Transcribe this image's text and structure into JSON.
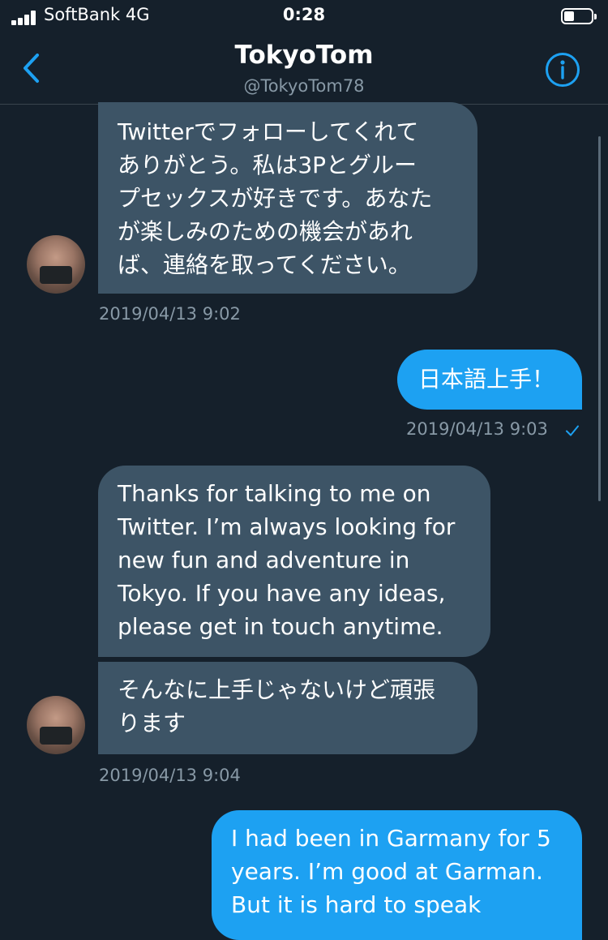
{
  "status_bar": {
    "carrier": "SoftBank 4G",
    "time": "0:28"
  },
  "header": {
    "title": "TokyoTom",
    "handle": "@TokyoTom78"
  },
  "messages": [
    {
      "direction": "received",
      "lines": [
        "Twitterでフォローしてくれて",
        "ありがとう。私は3Pとグルー",
        "プセックスが好きです。あなた",
        "が楽しみのための機会があれ",
        "ば、連絡を取ってください。"
      ]
    },
    {
      "direction": "sent",
      "lines": [
        "日本語上手！"
      ]
    },
    {
      "direction": "received",
      "lines": [
        "Thanks for talking to me on",
        "Twitter. I’m always looking for",
        "new fun and adventure in",
        "Tokyo. If you have any ideas,",
        "please get in touch anytime."
      ]
    },
    {
      "direction": "received",
      "lines": [
        "そんなに上手じゃないけど頑張",
        "ります"
      ]
    },
    {
      "direction": "sent",
      "lines": [
        "I had been in Garmany for 5",
        "years. I’m good at Garman.",
        "But it is hard to speak"
      ]
    }
  ],
  "timestamps": [
    "2019/04/13 9:02",
    "2019/04/13 9:03",
    "2019/04/13 9:04"
  ],
  "colors": {
    "background": "#15202b",
    "received_bubble": "#3d5466",
    "sent_bubble": "#1da1f2",
    "accent": "#1da1f2",
    "secondary_text": "#8899a6"
  },
  "icons": [
    "signal-icon",
    "battery-icon",
    "back-chevron-icon",
    "info-icon",
    "read-check-icon",
    "avatar"
  ]
}
